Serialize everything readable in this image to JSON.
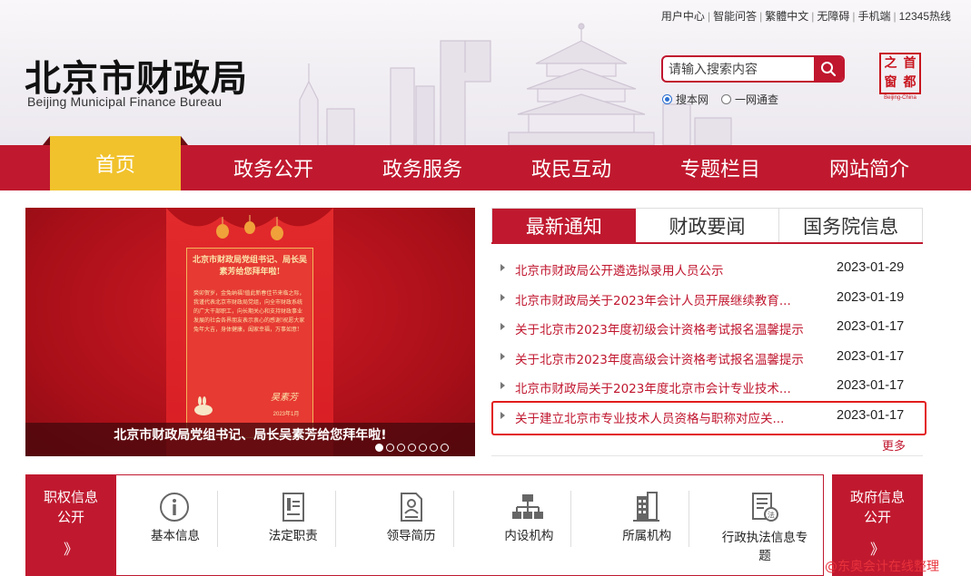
{
  "colors": {
    "brand_red": "#c0192f",
    "home_tab_yellow": "#f1c22c",
    "link_red": "#c0162e",
    "highlight_border": "#e21c1c"
  },
  "toplinks": [
    "用户中心",
    "智能问答",
    "繁體中文",
    "无障碍",
    "手机端",
    "12345热线"
  ],
  "logo": {
    "cn": "北京市财政局",
    "en": "Beijing Municipal Finance Bureau"
  },
  "search": {
    "placeholder": "请输入搜索内容",
    "options": [
      {
        "label": "搜本网",
        "selected": true
      },
      {
        "label": "一网通查",
        "selected": false
      }
    ]
  },
  "seal": {
    "chars": [
      "之",
      "首",
      "窗",
      "都"
    ],
    "en": "Beijing-China"
  },
  "nav": {
    "home": "首页",
    "items": [
      "政务公开",
      "政务服务",
      "政民互动",
      "专题栏目",
      "网站简介"
    ]
  },
  "banner": {
    "poster_heading": "北京市财政局党组书记、局长吴素芳给您拜年啦!",
    "poster_body": "癸卯贺岁，金兔纳福!值此新春佳节来临之际，我谨代表北京市财政局党组，向全市财政系统的广大干部职工，向长期关心和支持财政事业发展的社会各界朋友表示衷心的感谢!祝愿大家兔年大吉，身体健康，阖家幸福，万事如意!",
    "poster_sign": "吴素芳",
    "poster_date": "2023年1月",
    "caption": "北京市财政局党组书记、局长吴素芳给您拜年啦!",
    "slide_count": 7,
    "active_slide": 1
  },
  "news": {
    "tabs": [
      "最新通知",
      "财政要闻",
      "国务院信息"
    ],
    "items": [
      {
        "title": "北京市财政局公开遴选拟录用人员公示",
        "date": "2023-01-29"
      },
      {
        "title": "北京市财政局关于2023年会计人员开展继续教育...",
        "date": "2023-01-19"
      },
      {
        "title": "关于北京市2023年度初级会计资格考试报名温馨提示",
        "date": "2023-01-17"
      },
      {
        "title": "关于北京市2023年度高级会计资格考试报名温馨提示",
        "date": "2023-01-17"
      },
      {
        "title": "北京市财政局关于2023年度北京市会计专业技术...",
        "date": "2023-01-17"
      },
      {
        "title": "关于建立北京市专业技术人员资格与职称对应关...",
        "date": "2023-01-17"
      }
    ],
    "more": "更多"
  },
  "bottom": {
    "left_title_1": "职权信息",
    "left_title_2": "公开",
    "right_title_1": "政府信息",
    "right_title_2": "公开",
    "chevron": "》",
    "items": [
      {
        "label": "基本信息",
        "icon": "info-icon"
      },
      {
        "label": "法定职责",
        "icon": "document-icon"
      },
      {
        "label": "领导简历",
        "icon": "profile-icon"
      },
      {
        "label": "内设机构",
        "icon": "org-chart-icon"
      },
      {
        "label": "所属机构",
        "icon": "building-icon"
      },
      {
        "label": "行政执法信息专题",
        "icon": "law-document-icon"
      }
    ]
  },
  "watermark": "@东奥会计在线整理"
}
